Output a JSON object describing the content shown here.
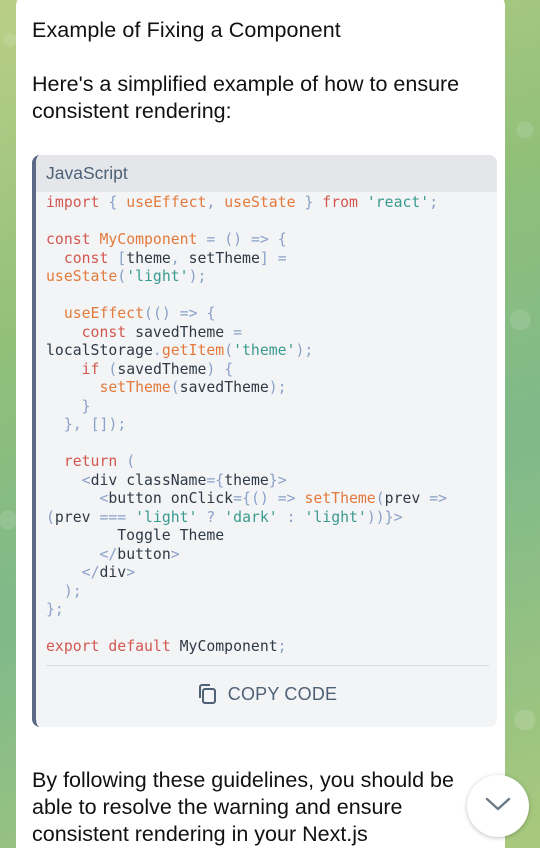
{
  "message": {
    "heading": "Example of Fixing a Component",
    "intro": "Here's a simplified example of how to ensure consistent rendering:",
    "outro": "By following these guidelines, you should be able to resolve the warning and ensure consistent rendering in your Next.js"
  },
  "code_block": {
    "language": "JavaScript",
    "copy_label": "COPY CODE",
    "copy_icon": "copy-icon",
    "lines": [
      "import { useEffect, useState } from 'react';",
      "",
      "const MyComponent = () => {",
      "  const [theme, setTheme] =",
      "useState('light');",
      "",
      "  useEffect(() => {",
      "    const savedTheme =",
      "localStorage.getItem('theme');",
      "    if (savedTheme) {",
      "      setTheme(savedTheme);",
      "    }",
      "  }, []);",
      "",
      "  return (",
      "    <div className={theme}>",
      "      <button onClick={() => setTheme(prev =>",
      "(prev === 'light' ? 'dark' : 'light'))}>",
      "        Toggle Theme",
      "      </button>",
      "    </div>",
      "  );",
      "};",
      "",
      "export default MyComponent;"
    ]
  },
  "scroll_button": {
    "icon": "chevron-down-icon"
  },
  "colors": {
    "keyword": "#d2574f",
    "function": "#e37a3c",
    "string": "#3b9a8f",
    "punctuation": "#8aa1c8",
    "text": "#2f3a46",
    "copy_label": "#4f6176"
  }
}
